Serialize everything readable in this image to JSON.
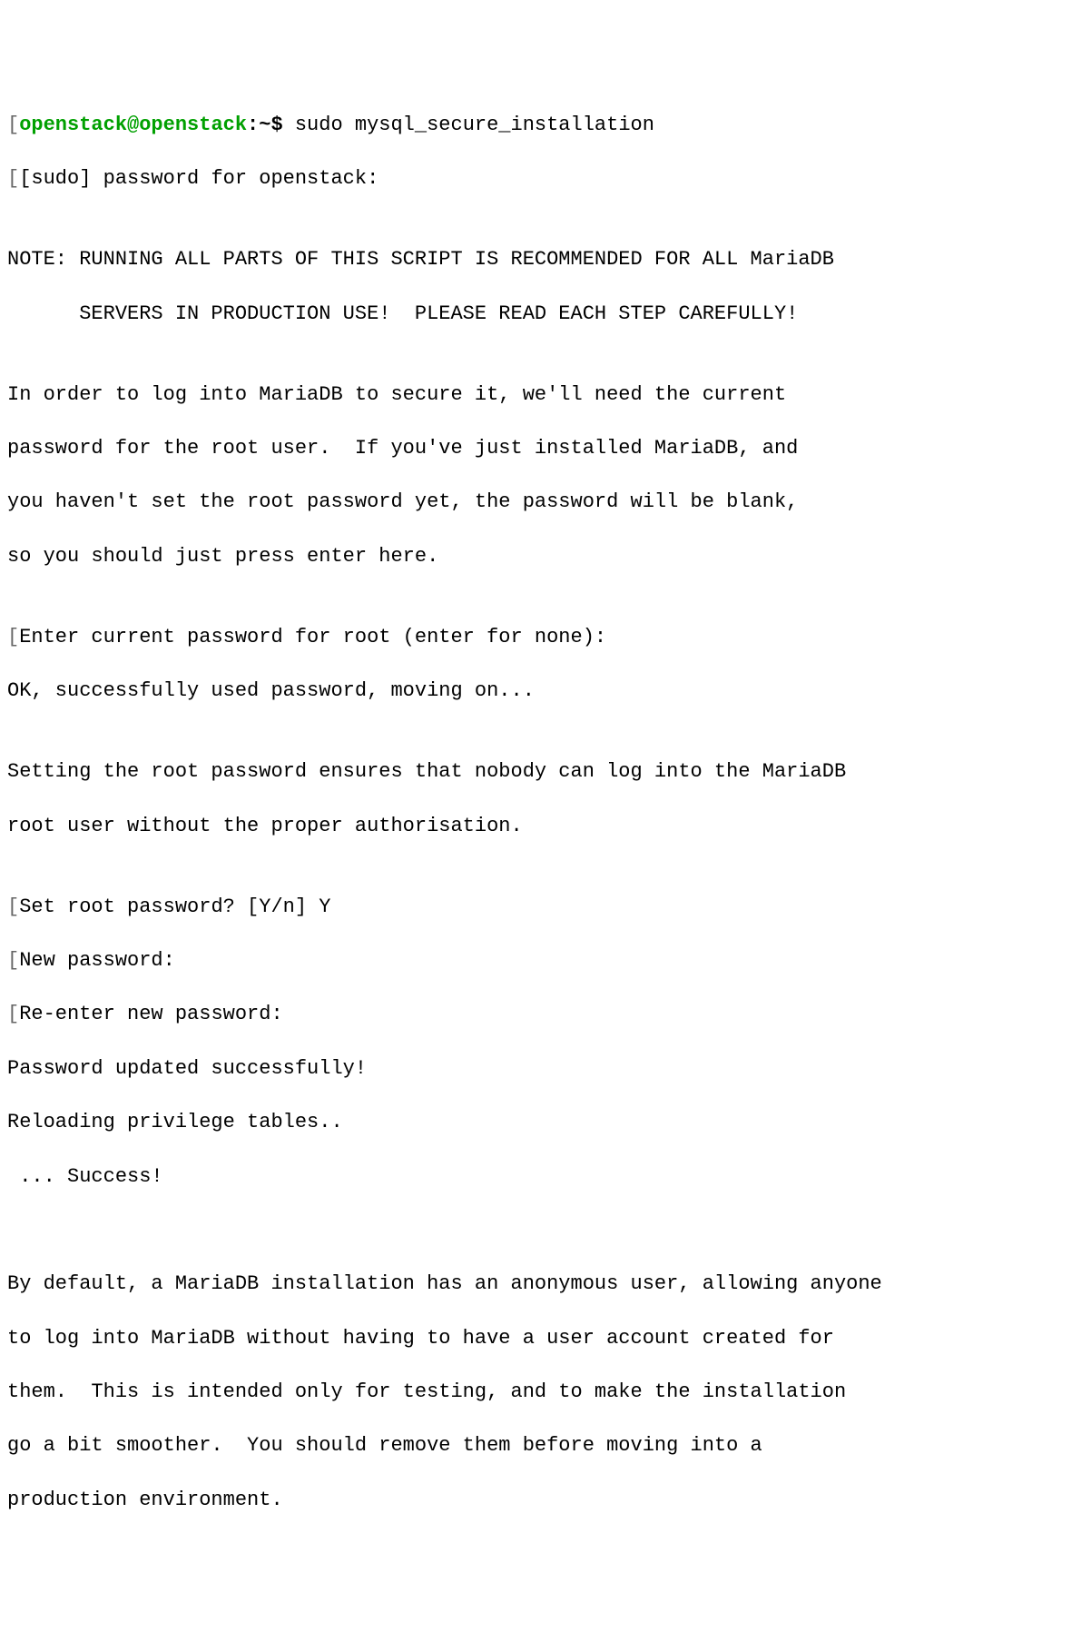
{
  "colors": {
    "prompt_green": "#00a000",
    "text_black": "#000000",
    "bg_white": "#ffffff"
  },
  "prompt": {
    "user_host": "openstack@openstack",
    "separator": ":",
    "path": "~",
    "sigil": "$"
  },
  "command": "sudo mysql_secure_installation",
  "lines": {
    "sudo_pw": "[sudo] password for openstack:",
    "blank1": "",
    "note1": "NOTE: RUNNING ALL PARTS OF THIS SCRIPT IS RECOMMENDED FOR ALL MariaDB",
    "note2": "      SERVERS IN PRODUCTION USE!  PLEASE READ EACH STEP CAREFULLY!",
    "blank2": "",
    "intro1": "In order to log into MariaDB to secure it, we'll need the current",
    "intro2": "password for the root user.  If you've just installed MariaDB, and",
    "intro3": "you haven't set the root password yet, the password will be blank,",
    "intro4": "so you should just press enter here.",
    "blank3": "",
    "enter_pw": "Enter current password for root (enter for none):",
    "ok_used": "OK, successfully used password, moving on...",
    "blank4": "",
    "setting1": "Setting the root password ensures that nobody can log into the MariaDB",
    "setting2": "root user without the proper authorisation.",
    "blank5": "",
    "set_root": "Set root password? [Y/n] Y",
    "new_pw": "New password:",
    "reenter_pw": "Re-enter new password:",
    "pw_updated": "Password updated successfully!",
    "reloading": "Reloading privilege tables..",
    "success": " ... Success!",
    "blank6": "",
    "blank7": "",
    "anon1": "By default, a MariaDB installation has an anonymous user, allowing anyone",
    "anon2": "to log into MariaDB without having to have a user account created for",
    "anon3": "them.  This is intended only for testing, and to make the installation",
    "anon4": "go a bit smoother.  You should remove them before moving into a",
    "anon5": "production environment."
  }
}
